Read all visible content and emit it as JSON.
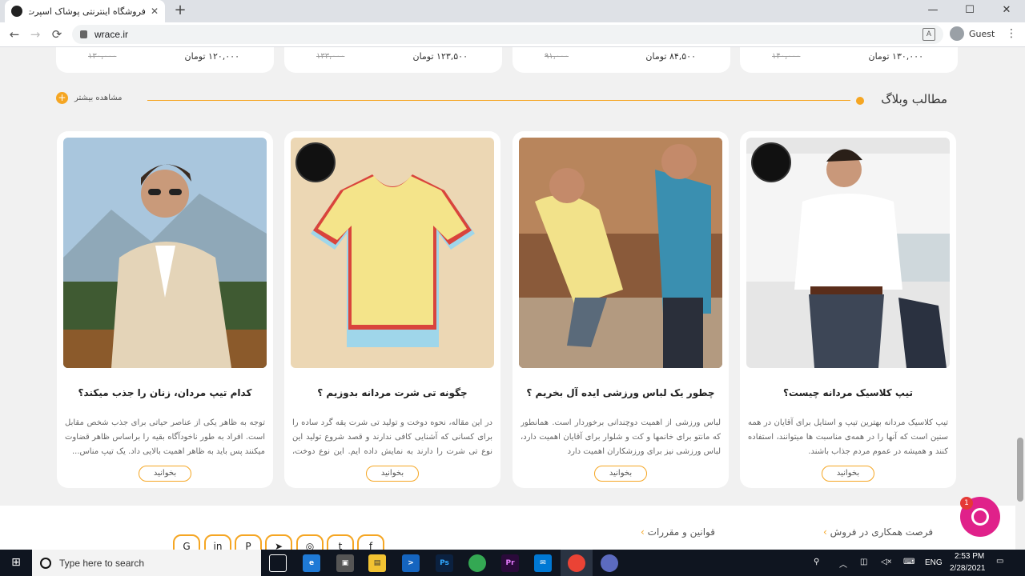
{
  "browser": {
    "tab_title": "فروشگاه اینترنتی پوشاک اسپرت و ر",
    "tab_close": "✕",
    "new_tab": "+",
    "url": "wrace.ir",
    "profile_label": "Guest",
    "minimize": "—",
    "maximize": "☐",
    "close": "✕"
  },
  "prices": [
    {
      "new": "۱۲۰,۰۰۰ تومان",
      "old": "۱۳۰,۰۰۰"
    },
    {
      "new": "۱۲۳,۵۰۰ تومان",
      "old": "۱۳۳,۰۰۰"
    },
    {
      "new": "۸۴,۵۰۰ تومان",
      "old": "۹۱,۰۰۰"
    },
    {
      "new": "۱۳۰,۰۰۰ تومان",
      "old": "۱۴۰,۰۰۰"
    }
  ],
  "blog": {
    "section_title": "مطالب وبلاگ",
    "see_more": "مشاهده بیشتر",
    "read_label": "بخوانید",
    "posts": [
      {
        "title": "کدام تیپ مردان، زنان را جذب میکند؟",
        "excerpt": "توجه به ظاهر یکی از عناصر حیاتی برای جذب شخص مقابل است. افراد به طور  ناخودآگاه بقیه را براساس ظاهر قضاوت میکنند پس باید به ظاهر اهمیت بالایی داد.  یک تیپ مناس..."
      },
      {
        "title": "چگونه تی شرت مردانه بدوزیم ؟",
        "excerpt": "در این مقاله، نحوه دوخت و تولید تی شرت یقه گرد ساده را برای کسانی که آشنایی کافی ندارند و  قصد شروع تولید این نوع تی شرت را دارند به نمایش داده ایم. این نوع دوخت، یک..."
      },
      {
        "title": "چطور یک لباس ورزشی ایده آل بخریم ؟",
        "excerpt": "لباس ورزشی از اهمیت دوچندانی برخوردار است. همانطور که مانتو برای خانمها و کت و شلوار برای آقایان اهمیت دارد، لباس ورزشی نیز برای ورزشکاران اهمیت دارد"
      },
      {
        "title": "تیپ کلاسیک مردانه چیست؟",
        "excerpt": "تیپ کلاسیک مردانه بهترین تیپ و استایل برای آقایان در همه سنین است که آنها را در همه‌ی مناسبت ها میتوانند، استفاده کنند و همیشه در عموم مردم جذاب باشند."
      }
    ]
  },
  "footer": {
    "links": [
      "فرصت همکاری در فروش",
      "قوانین و مقررات"
    ],
    "social_icons": [
      "google-icon",
      "linkedin-icon",
      "pinterest-icon",
      "telegram-icon",
      "instagram-icon",
      "twitter-icon",
      "facebook-icon"
    ]
  },
  "chat": {
    "badge_count": "1"
  },
  "taskbar": {
    "search_placeholder": "Type here to search",
    "language": "ENG",
    "time": "2:53 PM",
    "date": "2/28/2021",
    "icons": [
      "task-view-icon",
      "edge-icon",
      "store-icon",
      "file-explorer-icon",
      "terminal-icon",
      "photoshop-icon",
      "chrome-icon",
      "premiere-icon",
      "mail-icon",
      "chrome-active-icon",
      "app-icon"
    ]
  },
  "colors": {
    "accent": "#f5a623",
    "chat": "#e0218a"
  }
}
